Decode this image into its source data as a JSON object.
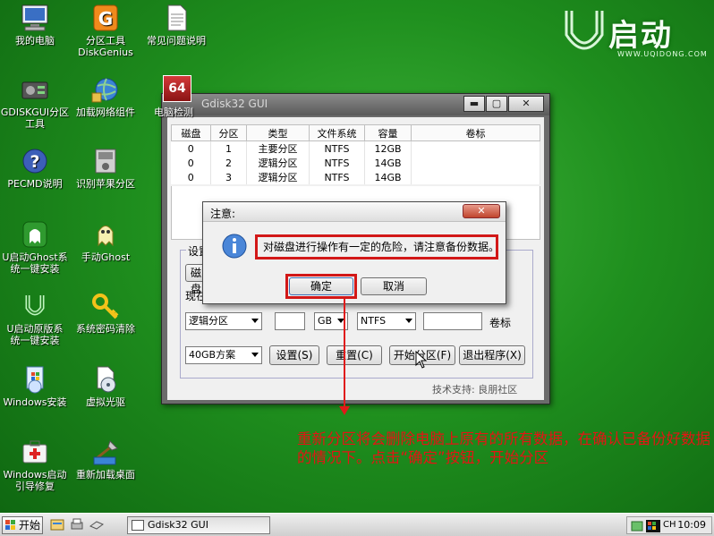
{
  "desktop": {
    "icons": [
      {
        "label": "我的电脑",
        "icon": "computer-icon"
      },
      {
        "label": "分区工具\nDiskGenius",
        "icon": "diskgenius-icon"
      },
      {
        "label": "常见问题说明",
        "icon": "document-icon"
      },
      {
        "label": "GDISKGUI分区\n工具",
        "icon": "gdisk-icon"
      },
      {
        "label": "加载网络组件",
        "icon": "network-globe-icon"
      },
      {
        "label": "电脑检测",
        "icon": "hardware-test-icon"
      },
      {
        "label": "PECMD说明",
        "icon": "help-icon"
      },
      {
        "label": "识别苹果分区",
        "icon": "apple-disk-icon"
      },
      {
        "label": "U启动Ghost系\n统一键安装",
        "icon": "ghost-green-icon"
      },
      {
        "label": "手动Ghost",
        "icon": "ghost-yellow-icon"
      },
      {
        "label": "U启动原版系\n统一键安装",
        "icon": "u-install-icon"
      },
      {
        "label": "系统密码清除",
        "icon": "key-icon"
      },
      {
        "label": "Windows安装",
        "icon": "windows-setup-icon"
      },
      {
        "label": "虚拟光驱",
        "icon": "virtual-drive-icon"
      },
      {
        "label": "Windows启动\n引导修复",
        "icon": "firstaid-icon"
      },
      {
        "label": "重新加载桌面",
        "icon": "reload-desktop-icon"
      }
    ]
  },
  "brand": {
    "name": "启动",
    "url": "WWW.UQIDONG.COM"
  },
  "window": {
    "title": "Gdisk32 GUI",
    "badge": "64",
    "controls": {
      "minimize": "▬",
      "maximize": "▢",
      "close": "✕"
    },
    "table": {
      "headers": [
        "磁盘",
        "分区",
        "类型",
        "文件系统",
        "容量",
        "卷标"
      ],
      "rows": [
        [
          "0",
          "1",
          "主要分区",
          "NTFS",
          "12GB",
          ""
        ],
        [
          "0",
          "2",
          "逻辑分区",
          "NTFS",
          "14GB",
          ""
        ],
        [
          "0",
          "3",
          "逻辑分区",
          "NTFS",
          "14GB",
          ""
        ]
      ]
    },
    "settings": {
      "group_label": "设置",
      "disk_label": "磁盘",
      "current_label": "现在",
      "type_value": "逻辑分区",
      "size_unit": "GB",
      "fs_value": "NTFS",
      "volume_label": "卷标",
      "scheme_value": "40GB方案"
    },
    "buttons": {
      "set": "设置(S)",
      "reset": "重置(C)",
      "start": "开始分区(F)",
      "exit": "退出程序(X)"
    },
    "support": "技术支持: 良朋社区"
  },
  "dialog": {
    "title": "注意:",
    "message": "对磁盘进行操作有一定的危险，请注意备份数据。",
    "ok": "确定",
    "cancel": "取消"
  },
  "annotation": "重新分区将会删除电脑上原有的所有数据，在确认已备份好数据的情况下。点击“确定”按钮，开始分区",
  "taskbar": {
    "start": "开始",
    "task_title": "Gdisk32 GUI",
    "lang": "CH",
    "clock": "10:09"
  },
  "colors": {
    "accent_red": "#e01a1a",
    "desktop_green": "#1f8f1e"
  }
}
